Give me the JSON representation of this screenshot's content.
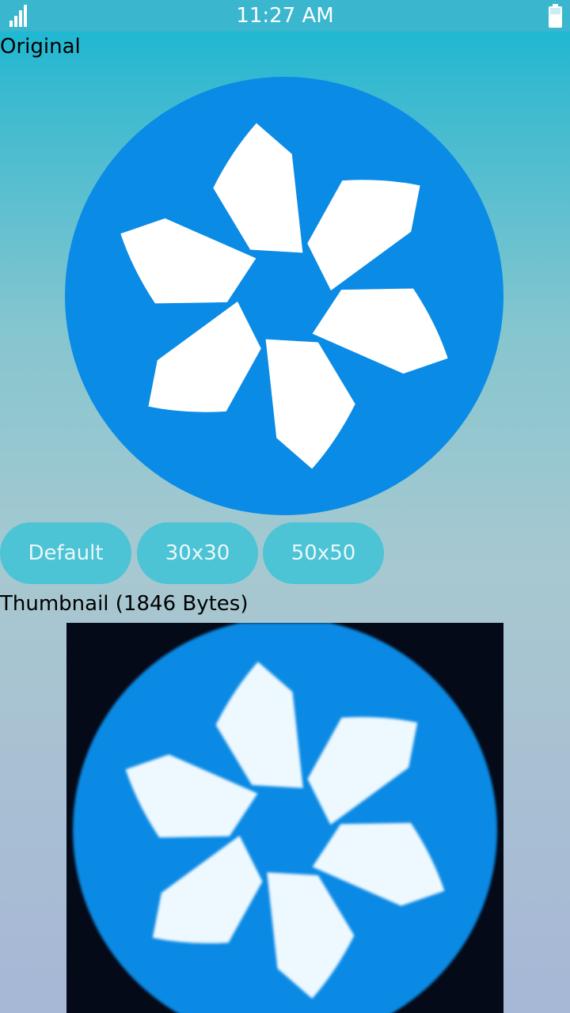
{
  "status_bar": {
    "time": "11:27 AM",
    "signal_icon": "signal-bars-icon",
    "battery_icon": "battery-icon"
  },
  "main": {
    "original_label": "Original",
    "original_image_icon": "pinwheel-logo",
    "buttons": [
      {
        "label": "Default"
      },
      {
        "label": "30x30"
      },
      {
        "label": "50x50"
      }
    ],
    "thumbnail_label": "Thumbnail (1846 Bytes)",
    "thumbnail_image_icon": "pinwheel-logo-thumbnail"
  },
  "colors": {
    "logo_blue": "#0a8be6",
    "logo_white": "#ffffff",
    "button_bg": "#4dc3d6",
    "thumb_bg": "#050a18"
  }
}
